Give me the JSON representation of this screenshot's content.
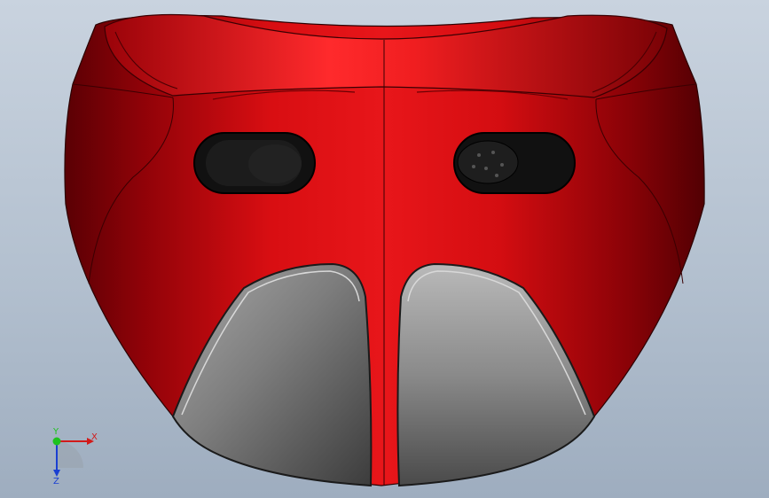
{
  "viewport": {
    "model": {
      "shell_color": "#d40f12",
      "shell_shadow": "#6a0005",
      "pad_color": "#8c8c8c",
      "vent_color": "#151515"
    },
    "triad": {
      "x_label": "X",
      "y_label": "Y",
      "z_label": "Z",
      "x_color": "#d21a1a",
      "y_color": "#1ec21e",
      "z_color": "#1a3fd2"
    }
  }
}
